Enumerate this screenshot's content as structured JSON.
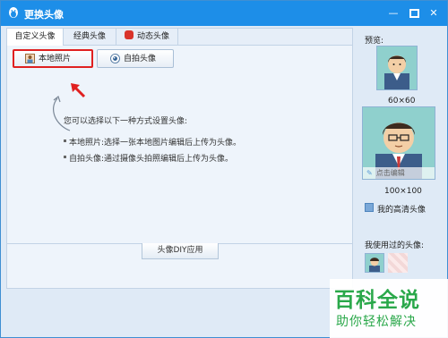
{
  "window": {
    "title": "更换头像"
  },
  "tabs": [
    {
      "label": "自定义头像"
    },
    {
      "label": "经典头像"
    },
    {
      "label": "动态头像"
    }
  ],
  "buttons": {
    "local_photo": "本地照片",
    "self_photo": "自拍头像"
  },
  "info": {
    "heading": "您可以选择以下一种方式设置头像:",
    "bullets": [
      "本地照片:选择一张本地图片编辑后上传为头像。",
      "自拍头像:通过摄像头拍照编辑后上传为头像。"
    ]
  },
  "diy_button": "头像DIY应用",
  "sidebar": {
    "preview_label": "预览:",
    "size_small": "60×60",
    "size_big": "100×100",
    "edit_label": "点击编辑",
    "hd_label": "我的高清头像",
    "used_label": "我使用过的头像:"
  },
  "watermark": {
    "big": "百科全说",
    "small": "助你轻松解决"
  },
  "colors": {
    "titlebar": "#1d8ee8",
    "highlight": "#e02020",
    "watermark": "#2aa84a"
  }
}
